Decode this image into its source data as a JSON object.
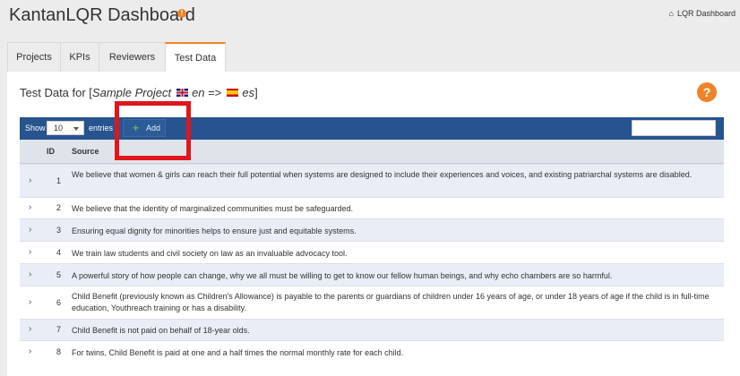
{
  "header": {
    "title": "KantanLQR Dashboard",
    "breadcrumb": "LQR Dashboard",
    "home_icon": "home-icon",
    "info_icon": "info-icon"
  },
  "tabs": [
    {
      "label": "Projects",
      "active": false
    },
    {
      "label": "KPIs",
      "active": false
    },
    {
      "label": "Reviewers",
      "active": false
    },
    {
      "label": "Test Data",
      "active": true
    }
  ],
  "panel": {
    "title_prefix": "Test Data for [",
    "project": "Sample Project",
    "source_lang": "en",
    "arrow": "=>",
    "target_lang": "es",
    "title_suffix": "]",
    "help_icon": "question-icon"
  },
  "toolbar": {
    "show_label": "Show",
    "entries_value": "10",
    "entries_label": "entries",
    "add_label": "Add",
    "search_value": ""
  },
  "table": {
    "columns": [
      "ID",
      "Source"
    ],
    "rows": [
      {
        "id": "1",
        "source": "We believe that women & girls can reach their full potential when systems are designed to include their experiences and voices, and existing patriarchal systems are disabled."
      },
      {
        "id": "2",
        "source": "We believe that the identity of marginalized communities must be safeguarded."
      },
      {
        "id": "3",
        "source": "Ensuring equal dignity for minorities helps to ensure just and equitable systems."
      },
      {
        "id": "4",
        "source": "We train law students and civil society on law as an invaluable advocacy tool."
      },
      {
        "id": "5",
        "source": "A powerful story of how people can change, why we all must be willing to get to know our fellow human beings, and why echo chambers are so harmful."
      },
      {
        "id": "6",
        "source": "Child Benefit (previously known as Children's Allowance) is payable to the parents or guardians of children under 16 years of age, or under 18 years of age if the child is in full-time education, Youthreach training or has a disability."
      },
      {
        "id": "7",
        "source": "Child Benefit is not paid on behalf of 18-year olds."
      },
      {
        "id": "8",
        "source": "For twins, Child Benefit is paid at one and a half times the normal monthly rate for each child."
      }
    ]
  },
  "colors": {
    "accent": "#f0832a",
    "toolbar": "#26548f",
    "highlight": "#e0161c"
  }
}
